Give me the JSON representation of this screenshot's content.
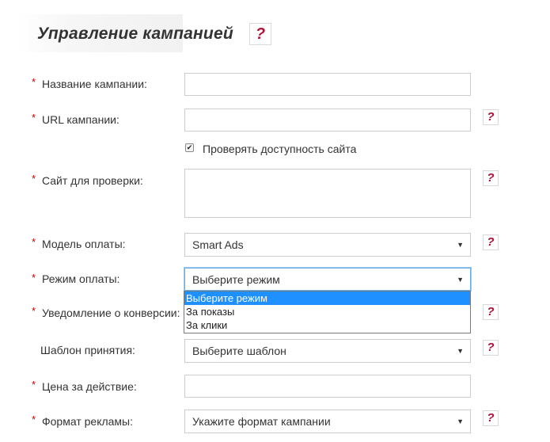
{
  "header": {
    "title": "Управление кампанией",
    "help": "?"
  },
  "form": {
    "required_mark": "*",
    "campaign_name": {
      "label": "Название кампании:",
      "value": ""
    },
    "campaign_url": {
      "label": "URL кампании:",
      "value": ""
    },
    "check_availability": {
      "label": "Проверять доступность сайта",
      "checked": true,
      "mark": "✔"
    },
    "check_site": {
      "label": "Сайт для проверки:",
      "value": ""
    },
    "payment_model": {
      "label": "Модель оплаты:",
      "selected": "Smart Ads"
    },
    "payment_mode": {
      "label": "Режим оплаты:",
      "selected": "Выберите режим",
      "options": [
        "Выберите режим",
        "За показы",
        "За клики"
      ]
    },
    "conversion_notice": {
      "label": "Уведомление о конверсии:"
    },
    "accept_template": {
      "label": "Шаблон принятия:",
      "selected": "Выберите шаблон"
    },
    "price_per_action": {
      "label": "Цена за действие:",
      "value": ""
    },
    "ad_format": {
      "label": "Формат рекламы:",
      "selected": "Укажите формат кампании"
    }
  },
  "icons": {
    "dropdown_arrow": "▼",
    "arrow_icon_name": "chevron-down-icon",
    "help_icon_name": "question-icon"
  },
  "colors": {
    "help_mark": "#b0123a",
    "required_mark": "#cc0000",
    "dropdown_highlight": "#1e90ff"
  }
}
